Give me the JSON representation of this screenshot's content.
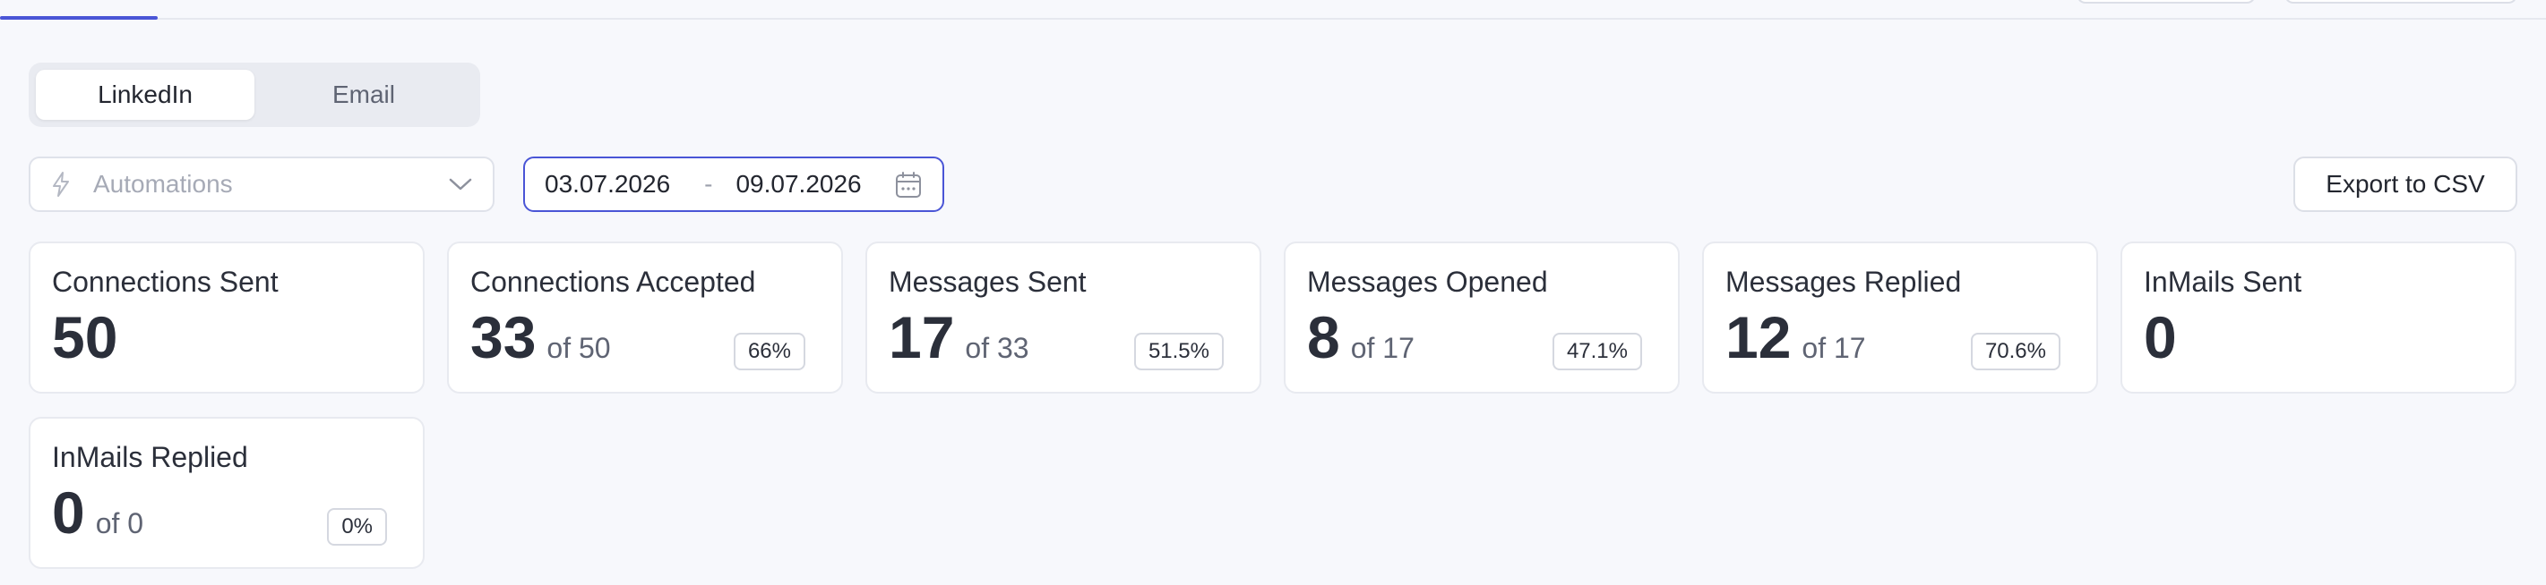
{
  "channel_toggle": {
    "options": [
      {
        "label": "LinkedIn",
        "active": true
      },
      {
        "label": "Email",
        "active": false
      }
    ]
  },
  "filters": {
    "automations_placeholder": "Automations",
    "date_from": "03.07.2026",
    "date_separator": "-",
    "date_to": "09.07.2026",
    "export_label": "Export to CSV"
  },
  "stats": {
    "connections_sent": {
      "title": "Connections Sent",
      "value": "50"
    },
    "connections_accepted": {
      "title": "Connections Accepted",
      "value": "33",
      "of": "of 50",
      "badge": "66%"
    },
    "messages_sent": {
      "title": "Messages Sent",
      "value": "17",
      "of": "of 33",
      "badge": "51.5%"
    },
    "messages_opened": {
      "title": "Messages Opened",
      "value": "8",
      "of": "of 17",
      "badge": "47.1%"
    },
    "messages_replied": {
      "title": "Messages Replied",
      "value": "12",
      "of": "of 17",
      "badge": "70.6%"
    },
    "inmails_sent": {
      "title": "InMails Sent",
      "value": "0"
    },
    "inmails_replied": {
      "title": "InMails Replied",
      "value": "0",
      "of": "of 0",
      "badge": "0%"
    }
  },
  "colors": {
    "accent": "#4a55d6",
    "background": "#f7f8fc",
    "card": "#ffffff"
  },
  "icons": {
    "automations": "bolt-icon",
    "select": "chevron-down-icon",
    "date": "calendar-icon"
  }
}
